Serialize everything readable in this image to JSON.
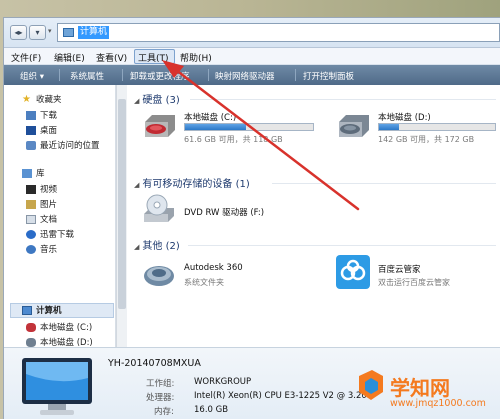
{
  "addressbar": {
    "path": "计算机"
  },
  "menubar": {
    "items": [
      {
        "label": "文件(F)"
      },
      {
        "label": "编辑(E)"
      },
      {
        "label": "查看(V)"
      },
      {
        "label": "工具(T)"
      },
      {
        "label": "帮助(H)"
      }
    ]
  },
  "commandbar": {
    "items": [
      {
        "label": "组织 ▾"
      },
      {
        "label": "系统属性"
      },
      {
        "label": "卸载或更改程序"
      },
      {
        "label": "映射网络驱动器"
      },
      {
        "label": "打开控制面板"
      }
    ]
  },
  "navpane": {
    "favorites": {
      "label": "收藏夹",
      "items": [
        {
          "label": "下载"
        },
        {
          "label": "桌面"
        },
        {
          "label": "最近访问的位置"
        }
      ]
    },
    "libraries": {
      "label": "库",
      "items": [
        {
          "label": "视频"
        },
        {
          "label": "图片"
        },
        {
          "label": "文档"
        },
        {
          "label": "迅雷下载"
        },
        {
          "label": "音乐"
        }
      ]
    },
    "computer": {
      "label": "计算机",
      "items": [
        {
          "label": "本地磁盘 (C:)"
        },
        {
          "label": "本地磁盘 (D:)"
        }
      ]
    }
  },
  "content": {
    "hard_disks": {
      "header": "硬盘 (3)",
      "drives": [
        {
          "name": "本地磁盘 (C:)",
          "usage": "61.6 GB 可用，共 118 GB",
          "used_fraction": 0.48
        },
        {
          "name": "本地磁盘 (D:)",
          "usage": "142 GB 可用，共 172 GB",
          "used_fraction": 0.17
        }
      ]
    },
    "removable": {
      "header": "有可移动存储的设备 (1)",
      "devices": [
        {
          "name": "DVD RW 驱动器 (F:)"
        }
      ]
    },
    "other": {
      "header": "其他 (2)",
      "items": [
        {
          "name": "Autodesk 360",
          "sub": "系统文件夹"
        },
        {
          "name": "百度云管家",
          "sub": "双击运行百度云管家"
        }
      ]
    }
  },
  "details": {
    "computer_name": "YH-20140708MXUA",
    "workgroup_label": "工作组:",
    "workgroup_value": "WORKGROUP",
    "processor_label": "处理器:",
    "processor_value": "Intel(R) Xeon(R) CPU E3-1225 V2 @ 3.20",
    "memory_label": "内存:",
    "memory_value": "16.0 GB"
  },
  "watermark": {
    "title": "学知网",
    "url": "www.jmqz1000.com"
  },
  "colors": {
    "accent_blue": "#3399ff",
    "arrow_red": "#d8322c",
    "watermark_orange": "#f47a1f"
  }
}
